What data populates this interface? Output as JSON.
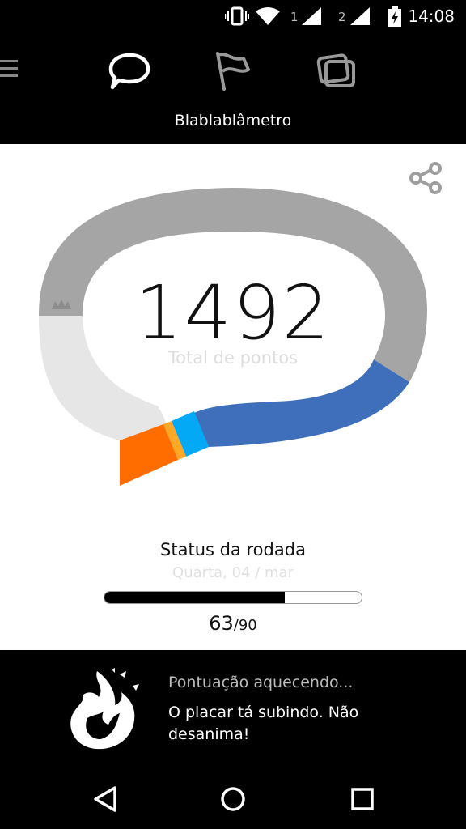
{
  "status_bar": {
    "time": "14:08",
    "sim1_label": "1",
    "sim2_label": "2",
    "icons": [
      "vibrate-icon",
      "wifi-icon",
      "signal-icon",
      "signal-icon",
      "battery-charging-icon"
    ]
  },
  "nav": {
    "title": "Blablablâmetro",
    "tabs": [
      "chat-icon",
      "flag-icon",
      "cards-icon"
    ],
    "menu_icon": "menu-icon"
  },
  "gauge": {
    "score": "1492",
    "score_label": "Total de pontos",
    "segments": [
      {
        "name": "orange",
        "color": "#ff6d00"
      },
      {
        "name": "light-orange",
        "color": "#ffa726"
      },
      {
        "name": "cyan",
        "color": "#03a9f4"
      },
      {
        "name": "blue",
        "color": "#3f6fba"
      },
      {
        "name": "gray",
        "color": "#a5a5a5"
      },
      {
        "name": "light-gray",
        "color": "#e6e6e6"
      }
    ],
    "crown_icon": "crown-icon",
    "share_icon": "share-icon"
  },
  "round": {
    "title": "Status da rodada",
    "date": "Quarta, 04 / mar",
    "current": "63",
    "total": "/90",
    "progress": 0.7
  },
  "banner": {
    "icon": "fire-icon",
    "title": "Pontuação aquecendo...",
    "message": "O placar tá subindo. Não desanima!"
  },
  "system_nav": [
    "back-icon",
    "home-icon",
    "recents-icon"
  ]
}
